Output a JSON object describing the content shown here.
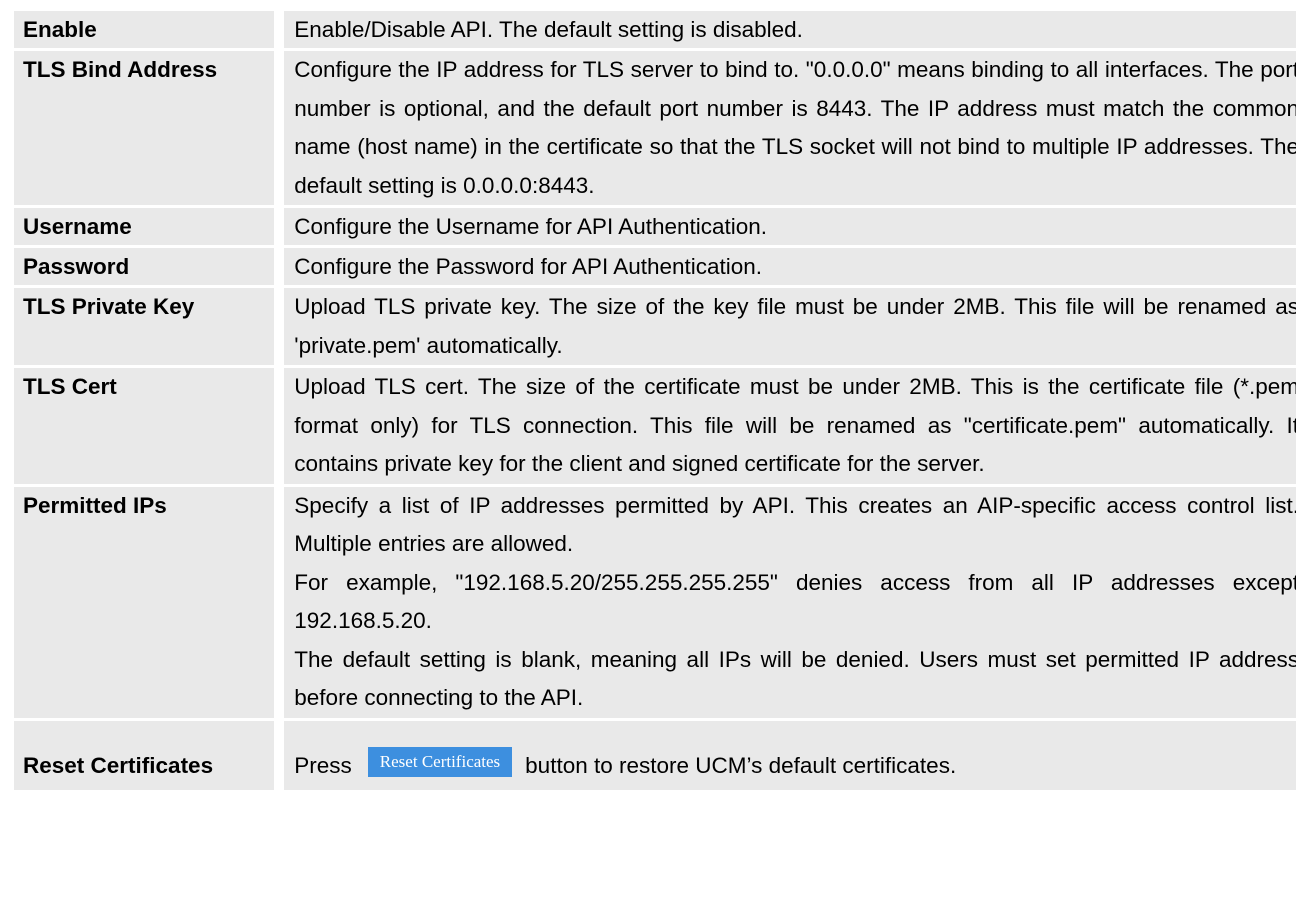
{
  "rows": [
    {
      "label": "Enable",
      "desc": [
        "Enable/Disable API. The default setting is disabled."
      ]
    },
    {
      "label": "TLS Bind Address",
      "desc": [
        "Configure the IP address for TLS server to bind to. \"0.0.0.0\" means binding to all interfaces. The port number is optional, and the default port number is 8443. The IP address must match the common name (host name) in the certificate so that the TLS socket will not bind to multiple IP addresses. The default setting is 0.0.0.0:8443."
      ]
    },
    {
      "label": "Username",
      "desc": [
        "Configure the Username for API Authentication."
      ]
    },
    {
      "label": "Password",
      "desc": [
        "Configure the Password for API Authentication."
      ]
    },
    {
      "label": "TLS Private Key",
      "desc": [
        "Upload TLS private key. The size of the key file must be under 2MB. This file will be renamed as 'private.pem' automatically."
      ]
    },
    {
      "label": "TLS Cert",
      "desc": [
        "Upload TLS cert. The size of the certificate must be under 2MB. This is the certificate file (*.pem format only) for TLS connection. This file will be renamed as \"certificate.pem\" automatically. It contains private key for the client and signed certificate for the server."
      ]
    },
    {
      "label": "Permitted IPs",
      "desc": [
        "Specify a list of IP addresses permitted by API. This creates an AIP-specific access control list. Multiple entries are allowed.",
        "For example, \"192.168.5.20/255.255.255.255\" denies access from all IP addresses except 192.168.5.20.",
        "The default setting is blank, meaning all IPs will be denied. Users must set permitted IP address before connecting to the API."
      ]
    }
  ],
  "reset": {
    "label": "Reset Certificates",
    "prefix": "Press",
    "button_label": "Reset Certificates",
    "suffix": "button to restore UCM’s default certificates."
  },
  "colors": {
    "row_background": "#e9e9e9",
    "button_background": "#3d8fdf",
    "button_text": "#ffffff"
  }
}
